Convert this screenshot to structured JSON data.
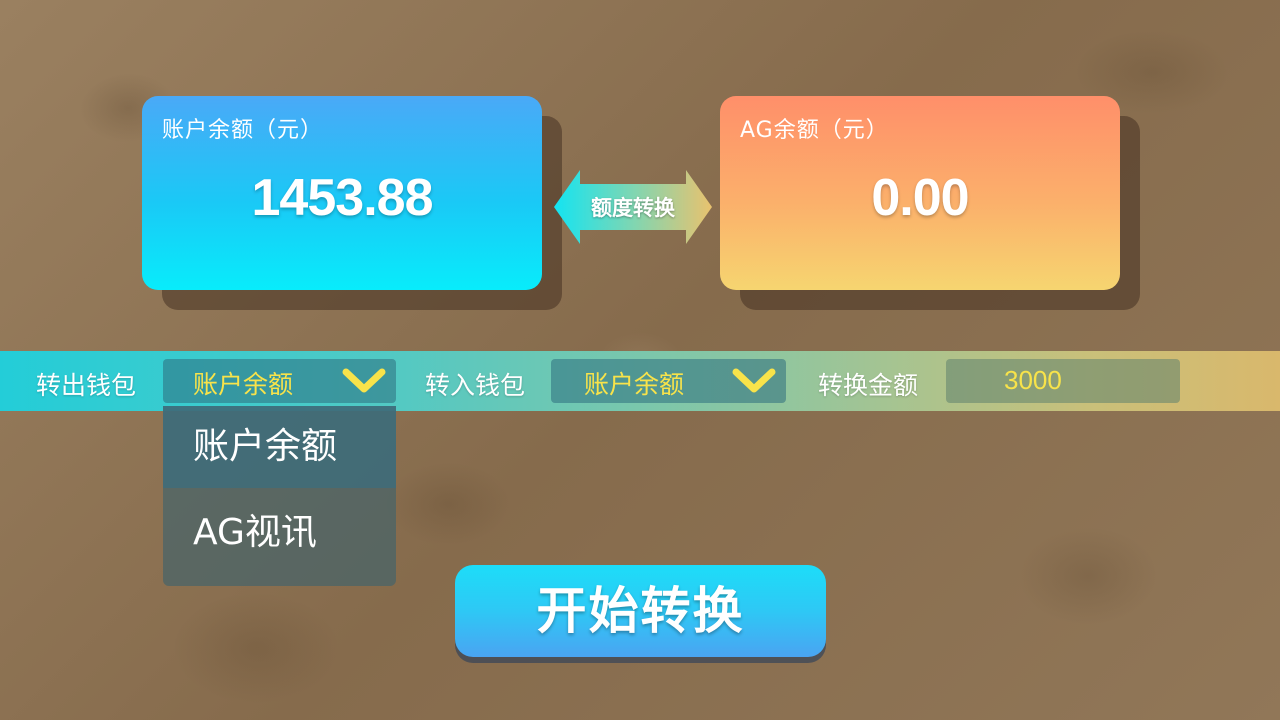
{
  "account_card": {
    "title": "账户余额（元）",
    "value": "1453.88"
  },
  "ag_card": {
    "title": "AG余额（元）",
    "value": "0.00"
  },
  "swap": {
    "label": "额度转换"
  },
  "transfer": {
    "out_label": "转出钱包",
    "out_selected": "账户余额",
    "in_label": "转入钱包",
    "in_selected": "账户余额",
    "amount_label": "转换金额",
    "amount_value": "3000"
  },
  "dropdown": {
    "items": [
      {
        "label": "账户余额"
      },
      {
        "label": "AG视讯"
      }
    ]
  },
  "start_button": {
    "label": "开始转换"
  },
  "colors": {
    "accent_yellow": "#f8e34a",
    "card_blue_top": "#4aa9f7",
    "card_blue_bottom": "#08ecfb",
    "card_orange_top": "#ff8f6a",
    "card_orange_bottom": "#f6d570"
  },
  "icons": {
    "select_arrow": "chevron-down-icon",
    "swap_arrow": "double-arrow-icon"
  }
}
